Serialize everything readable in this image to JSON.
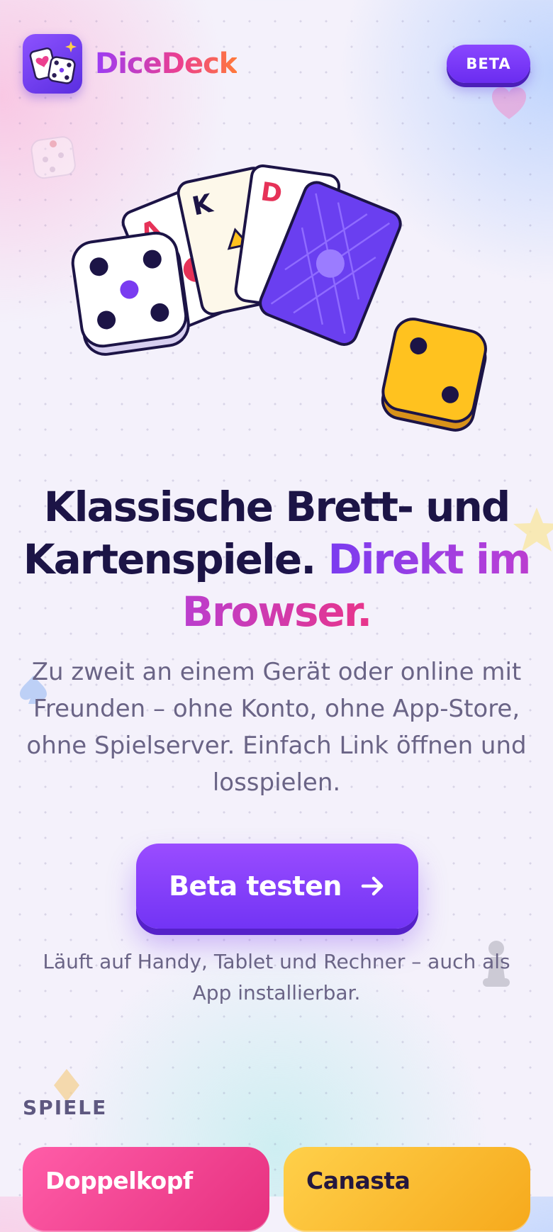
{
  "header": {
    "brand": "DiceDeck",
    "badge": "BETA"
  },
  "hero": {
    "cards": [
      "A",
      "K",
      "D"
    ],
    "headline_plain": "Klassische Brett- und Kartenspiele.",
    "headline_accent": "Direkt im Browser.",
    "subtitle": "Zu zweit an einem Gerät oder online mit Freunden – ohne Konto, ohne App-Store, ohne Spielserver. Einfach Link öffnen und losspielen.",
    "cta_label": "Beta testen",
    "note": "Läuft auf Handy, Tablet und Rechner – auch als App installierbar."
  },
  "games": {
    "section_label": "SPIELE",
    "items": [
      {
        "title": "Doppelkopf"
      },
      {
        "title": "Canasta"
      }
    ]
  },
  "colors": {
    "primary": "#7a3cf0",
    "accent_pink": "#e8358a",
    "ink": "#1c1446",
    "muted": "#6a6486",
    "die_yellow": "#ffc21f"
  },
  "icons": [
    "dice-cards-logo-icon",
    "arrow-right-icon",
    "heart-icon",
    "star-icon",
    "spade-icon",
    "diamond-icon",
    "pawn-icon",
    "die-icon"
  ]
}
